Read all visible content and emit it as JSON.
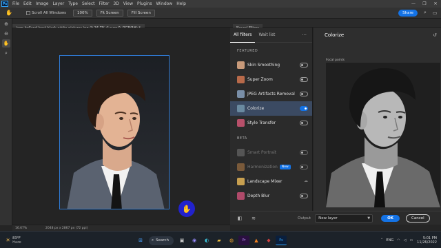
{
  "app": {
    "logo": "Ps",
    "menu": [
      "File",
      "Edit",
      "Image",
      "Layer",
      "Type",
      "Select",
      "Filter",
      "3D",
      "View",
      "Plugins",
      "Window",
      "Help"
    ],
    "window_controls": [
      "—",
      "❐",
      "✕"
    ]
  },
  "options": {
    "scroll_all_windows": "Scroll All Windows",
    "zoom_100": "100%",
    "fit_screen": "Fit Screen",
    "fill_screen": "Fill Screen",
    "share": "Share"
  },
  "document": {
    "tab_title": "tom-holland-best-black-white-pictures.jpg @ 16.7% (Layer 0, RGB/8#) *",
    "zoom": "16.67%",
    "info": "2048 px x 2867 px (72 ppi)"
  },
  "neural_filters": {
    "panel_tab": "Neural Filters",
    "tabs": [
      "All filters",
      "Wait list"
    ],
    "more": "···",
    "featured_heading": "FEATURED",
    "featured": [
      {
        "label": "Skin Smoothing",
        "state": "off",
        "color": "#c89a7a"
      },
      {
        "label": "Super Zoom",
        "state": "off",
        "color": "#b86a4a"
      },
      {
        "label": "JPEG Artifacts Removal",
        "state": "off",
        "color": "#7a8fa8"
      },
      {
        "label": "Colorize",
        "state": "on",
        "color": "#6a8aa0"
      },
      {
        "label": "Style Transfer",
        "state": "off",
        "color": "#b8506a"
      }
    ],
    "beta_heading": "BETA",
    "beta": [
      {
        "label": "Smart Portrait",
        "state": "off-dim",
        "color": "#555555",
        "badge": ""
      },
      {
        "label": "Harmonization",
        "state": "off-dim",
        "color": "#7a5a3a",
        "badge": "New"
      },
      {
        "label": "Landscape Mixer",
        "state": "cloud",
        "color": "#c8a050",
        "badge": ""
      },
      {
        "label": "Depth Blur",
        "state": "off",
        "color": "#b04a6a",
        "badge": ""
      }
    ]
  },
  "preview": {
    "title": "Colorize",
    "focal_points": "Focal points"
  },
  "actions": {
    "output_label": "Output",
    "output_value": "New layer",
    "ok": "OK",
    "cancel": "Cancel"
  },
  "taskbar": {
    "weather_temp": "83°F",
    "weather_desc": "Haze",
    "search": "Search",
    "lang": "ENG",
    "time": "5:01 PM",
    "date": "11/26/2022"
  },
  "colors": {
    "accent": "#1473e6",
    "selection": "#2f7bd6",
    "hand_button": "#2222cc"
  }
}
